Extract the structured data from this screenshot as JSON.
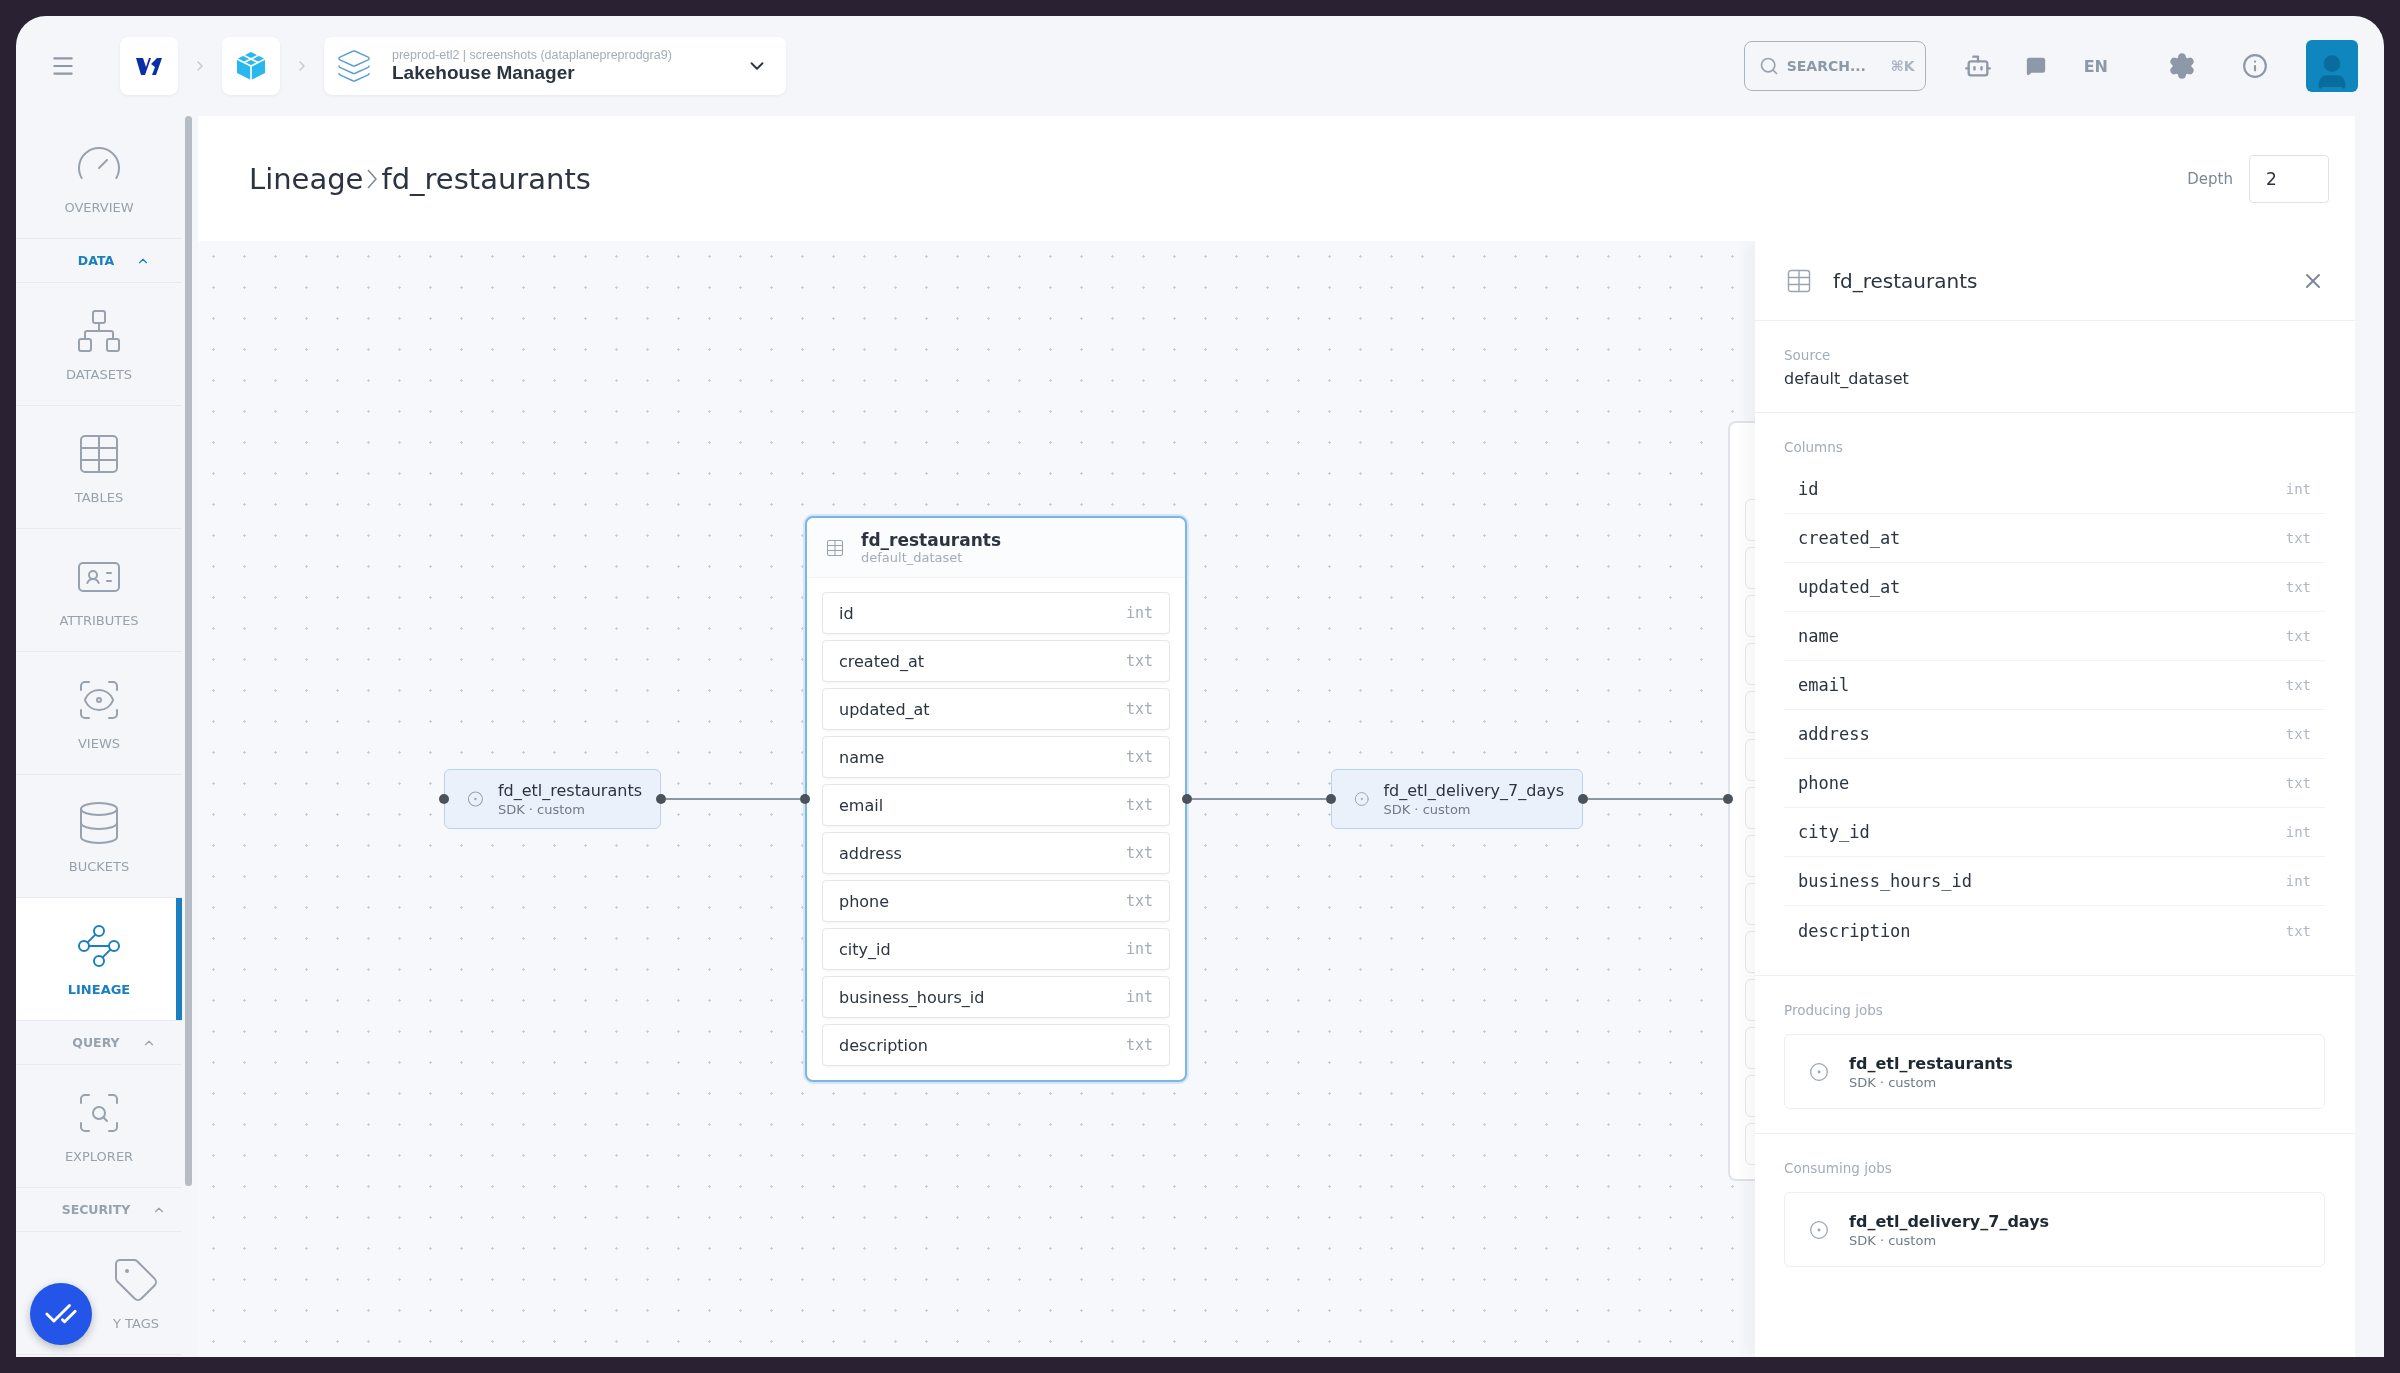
{
  "topbar": {
    "project": {
      "context": "preprod-etl2 | screenshots (dataplanepreprodgra9)",
      "title": "Lakehouse Manager"
    },
    "search": {
      "placeholder": "SEARCH...",
      "shortcut": "⌘K"
    },
    "language": "EN"
  },
  "sidebar": {
    "items": [
      {
        "kind": "overview",
        "label": "OVERVIEW",
        "selected": false
      },
      {
        "kind": "section",
        "label": "DATA",
        "expanded": true
      },
      {
        "kind": "datasets",
        "label": "DATASETS",
        "selected": false
      },
      {
        "kind": "tables",
        "label": "TABLES",
        "selected": false
      },
      {
        "kind": "attributes",
        "label": "ATTRIBUTES",
        "selected": false
      },
      {
        "kind": "views",
        "label": "VIEWS",
        "selected": false
      },
      {
        "kind": "buckets",
        "label": "BUCKETS",
        "selected": false
      },
      {
        "kind": "lineage",
        "label": "LINEAGE",
        "selected": true
      },
      {
        "kind": "section",
        "label": "QUERY",
        "expanded": true
      },
      {
        "kind": "explorer",
        "label": "EXPLORER",
        "selected": false
      },
      {
        "kind": "section",
        "label": "SECURITY",
        "expanded": true
      },
      {
        "kind": "tags",
        "label": "Y TAGS",
        "selected": false
      }
    ]
  },
  "page": {
    "title": "Lineage",
    "current": "fd_restaurants",
    "depth": {
      "label": "Depth",
      "value": "2"
    }
  },
  "graph": {
    "nodes": [
      {
        "kind": "job",
        "name": "fd_etl_restaurants",
        "meta": "SDK · custom"
      },
      {
        "kind": "table",
        "name": "fd_restaurants",
        "source": "default_dataset",
        "selected": true,
        "columns": [
          {
            "name": "id",
            "type": "int"
          },
          {
            "name": "created_at",
            "type": "txt"
          },
          {
            "name": "updated_at",
            "type": "txt"
          },
          {
            "name": "name",
            "type": "txt"
          },
          {
            "name": "email",
            "type": "txt"
          },
          {
            "name": "address",
            "type": "txt"
          },
          {
            "name": "phone",
            "type": "txt"
          },
          {
            "name": "city_id",
            "type": "int"
          },
          {
            "name": "business_hours_id",
            "type": "int"
          },
          {
            "name": "description",
            "type": "txt"
          }
        ]
      },
      {
        "kind": "job",
        "name": "fd_etl_delivery_7_days",
        "meta": "SDK · custom"
      },
      {
        "kind": "covered"
      }
    ]
  },
  "panel": {
    "title": "fd_restaurants",
    "source_label": "Source",
    "source": "default_dataset",
    "columns_label": "Columns",
    "columns": [
      {
        "name": "id",
        "type": "int"
      },
      {
        "name": "created_at",
        "type": "txt"
      },
      {
        "name": "updated_at",
        "type": "txt"
      },
      {
        "name": "name",
        "type": "txt"
      },
      {
        "name": "email",
        "type": "txt"
      },
      {
        "name": "address",
        "type": "txt"
      },
      {
        "name": "phone",
        "type": "txt"
      },
      {
        "name": "city_id",
        "type": "int"
      },
      {
        "name": "business_hours_id",
        "type": "int"
      },
      {
        "name": "description",
        "type": "txt"
      }
    ],
    "producing_label": "Producing jobs",
    "producing": [
      {
        "name": "fd_etl_restaurants",
        "meta": "SDK · custom"
      }
    ],
    "consuming_label": "Consuming jobs",
    "consuming": [
      {
        "name": "fd_etl_delivery_7_days",
        "meta": "SDK · custom"
      }
    ]
  }
}
